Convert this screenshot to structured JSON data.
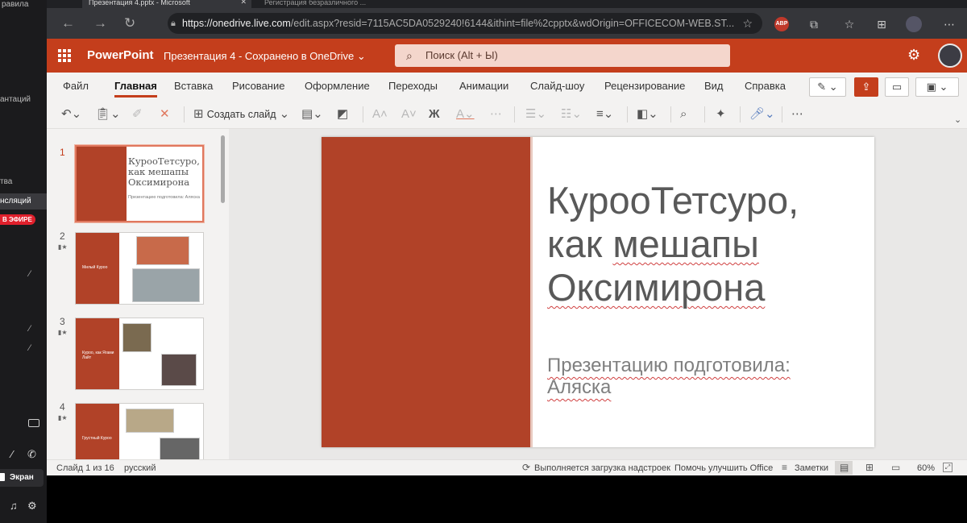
{
  "left_panel": {
    "rules_text": "равила",
    "translations_text": "антаций",
    "tva_text": "тва",
    "active_item": "нсляций",
    "live_badge": "В ЭФИРЕ",
    "screen_label": "Экран"
  },
  "browser": {
    "tabs": [
      {
        "label": "Презентация 4.pptx - Microsoft",
        "close": "✕"
      },
      {
        "label": "Регистрация безразличного ..."
      }
    ],
    "url_host": "https://onedrive.live.com",
    "url_rest": "/edit.aspx?resid=7115AC5DA0529240!6144&ithint=file%2cpptx&wdOrigin=OFFICECOM-WEB.ST...",
    "abp_label": "ABP"
  },
  "office": {
    "app_name": "PowerPoint",
    "doc_title": "Презентация 4 - Сохранено в OneDrive ⌄",
    "search_placeholder": "Поиск (Alt + Ы)"
  },
  "ribbon": {
    "tabs": [
      "Файл",
      "Главная",
      "Вставка",
      "Рисование",
      "Оформление",
      "Переходы",
      "Анимации",
      "Слайд-шоу",
      "Рецензирование",
      "Вид",
      "Справка"
    ],
    "selected_tab": "Главная",
    "new_slide_label": "Создать слайд"
  },
  "thumbnails": [
    {
      "number": "1",
      "title": "КурооТетсуро, как мешапы Оксимирона",
      "subtitle": "Презентацию подготовила: Аляска"
    },
    {
      "number": "2",
      "caption": "Милый Куроо"
    },
    {
      "number": "3",
      "caption": "Куроо, как Ягами Лайт"
    },
    {
      "number": "4",
      "caption": "Грустный Куроо"
    }
  ],
  "slide": {
    "title": "КурооТетсуро, как мешапы Оксимирона",
    "title_line1": "КурооТетсуро,",
    "title_line2_a": "как ",
    "title_line2_b": "мешапы",
    "title_line3": "Оксимирона",
    "subtitle_line1": "Презентацию подготовила:",
    "subtitle_line2": "Аляска",
    "accent_color": "#b14228"
  },
  "status": {
    "slide_count": "Слайд 1 из 16",
    "language": "русский",
    "addins_loading": "Выполняется загрузка надстроек",
    "improve": "Помочь улучшить Office",
    "notes": "Заметки",
    "zoom": "60%"
  }
}
